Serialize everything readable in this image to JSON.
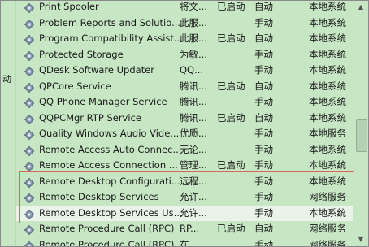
{
  "left_pane": {
    "label": "动"
  },
  "services": [
    {
      "name": "Print Spooler",
      "desc": "将文...",
      "status": "已启动",
      "startup": "自动",
      "logon": "本地系统"
    },
    {
      "name": "Problem Reports and Solutio...",
      "desc": "此服...",
      "status": "",
      "startup": "手动",
      "logon": "本地系统"
    },
    {
      "name": "Program Compatibility Assist...",
      "desc": "此服...",
      "status": "已启动",
      "startup": "自动",
      "logon": "本地系统"
    },
    {
      "name": "Protected Storage",
      "desc": "为敏...",
      "status": "",
      "startup": "手动",
      "logon": "本地系统"
    },
    {
      "name": "QDesk Software Updater",
      "desc": "QQ...",
      "status": "",
      "startup": "手动",
      "logon": "本地系统"
    },
    {
      "name": "QPCore Service",
      "desc": "腾讯...",
      "status": "已启动",
      "startup": "自动",
      "logon": "本地系统"
    },
    {
      "name": "QQ Phone Manager Service",
      "desc": "腾讯...",
      "status": "",
      "startup": "手动",
      "logon": "本地系统"
    },
    {
      "name": "QQPCMgr RTP Service",
      "desc": "腾讯...",
      "status": "已启动",
      "startup": "自动",
      "logon": "本地系统"
    },
    {
      "name": "Quality Windows Audio Vide...",
      "desc": "优质...",
      "status": "",
      "startup": "手动",
      "logon": "本地服务"
    },
    {
      "name": "Remote Access Auto Connec...",
      "desc": "无论...",
      "status": "",
      "startup": "手动",
      "logon": "本地系统"
    },
    {
      "name": "Remote Access Connection ...",
      "desc": "管理...",
      "status": "已启动",
      "startup": "手动",
      "logon": "本地系统"
    },
    {
      "name": "Remote Desktop Configurati...",
      "desc": "远程...",
      "status": "",
      "startup": "手动",
      "logon": "本地系统"
    },
    {
      "name": "Remote Desktop Services",
      "desc": "允许...",
      "status": "",
      "startup": "手动",
      "logon": "网络服务"
    },
    {
      "name": "Remote Desktop Services Us...",
      "desc": "允许...",
      "status": "",
      "startup": "手动",
      "logon": "本地系统"
    },
    {
      "name": "Remote Procedure Call (RPC)",
      "desc": "RP...",
      "status": "已启动",
      "startup": "自动",
      "logon": "网络服务"
    },
    {
      "name": "Remote Procedure Call (RPC)...",
      "desc": "在 ...",
      "status": "",
      "startup": "手动",
      "logon": "网络服务"
    }
  ],
  "colors": {
    "background": "#c6e6c4",
    "highlight_border": "#d4685d",
    "hover_row": "#eaf3ea"
  },
  "icons": {
    "service": "gear-icon"
  }
}
